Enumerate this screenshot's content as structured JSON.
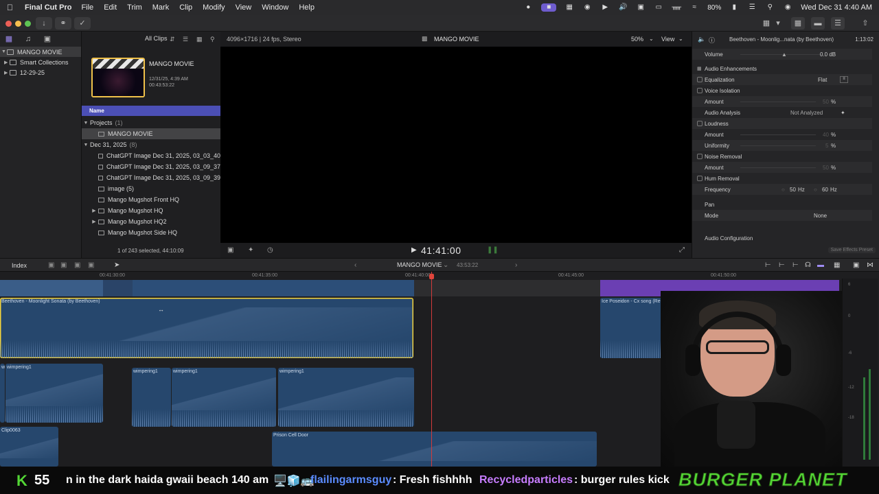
{
  "menubar": {
    "app_name": "Final Cut Pro",
    "items": [
      "File",
      "Edit",
      "Trim",
      "Mark",
      "Clip",
      "Modify",
      "View",
      "Window",
      "Help"
    ],
    "battery": "80%",
    "clock": "Wed Dec 31  4:40 AM"
  },
  "libraries": {
    "tabs": [
      "libraries-icon",
      "photos-icon",
      "titles-icon"
    ],
    "items": [
      {
        "label": "MANGO MOVIE",
        "selected": true
      },
      {
        "label": "Smart Collections"
      },
      {
        "label": "12-29-25"
      }
    ]
  },
  "browser": {
    "filter": "All Clips",
    "project_card": {
      "title": "MANGO MOVIE",
      "date": "12/31/25, 4:39 AM",
      "duration": "00:43:53:22"
    },
    "column_header": "Name",
    "rows": [
      {
        "label": "Projects",
        "count": "(1)",
        "group": true
      },
      {
        "label": "MANGO MOVIE",
        "selected": true
      },
      {
        "label": "Dec 31, 2025",
        "count": "(8)",
        "group": true
      },
      {
        "label": "ChatGPT Image Dec 31, 2025, 03_03_40"
      },
      {
        "label": "ChatGPT Image Dec 31, 2025, 03_09_37"
      },
      {
        "label": "ChatGPT Image Dec 31, 2025, 03_09_39"
      },
      {
        "label": "image (5)"
      },
      {
        "label": "Mango Mugshot Front HQ"
      },
      {
        "label": "Mango Mugshot HQ"
      },
      {
        "label": "Mango Mugshot HQ2"
      },
      {
        "label": "Mango Mugshot Side HQ"
      }
    ],
    "status": "1 of 243 selected, 44:10:09"
  },
  "viewer": {
    "format": "4096×1716 | 24 fps, Stereo",
    "title": "MANGO MOVIE",
    "zoom": "50%",
    "view_label": "View",
    "timecode": "41:41:00"
  },
  "inspector": {
    "clip_title": "Beethoven - Moonlig...nata (by Beethoven)",
    "duration": "1:13:02",
    "volume_label": "Volume",
    "volume_value": "0.0  dB",
    "enhancements_label": "Audio Enhancements",
    "equalization_label": "Equalization",
    "equalization_value": "Flat",
    "voice_isolation_label": "Voice Isolation",
    "amount_label": "Amount",
    "voice_amount": "50",
    "percent": "%",
    "analysis_label": "Audio Analysis",
    "analysis_value": "Not Analyzed",
    "loudness_label": "Loudness",
    "loudness_amount": "40",
    "uniformity_label": "Uniformity",
    "uniformity_value": "5",
    "noise_label": "Noise Removal",
    "noise_amount": "50",
    "hum_label": "Hum Removal",
    "frequency_label": "Frequency",
    "freq_50": "50",
    "freq_60": "60",
    "hz": "Hz",
    "pan_label": "Pan",
    "mode_label": "Mode",
    "mode_value": "None",
    "config_label": "Audio Configuration",
    "save_label": "Save Effects Preset"
  },
  "timeline_bar": {
    "index_label": "Index",
    "project": "MANGO MOVIE",
    "duration": "43:53:22"
  },
  "timeline": {
    "ruler": [
      "00:41:30:00",
      "00:41:35:00",
      "00:41:40:00",
      "00:41:45:00",
      "00:41:50:00"
    ],
    "clips": {
      "beethoven": "Beethoven - Moonlight Sonata (by Beethoven)",
      "poseidon": "Ice Poseidon - Cx song (Reupload)",
      "w": "w",
      "wimp1": "wimpering1",
      "wimp2": "wimpering1",
      "wimp3": "wimpering1",
      "wimp4": "wimpering1",
      "clip0063": "Clip0063",
      "prison": "Prison Cell Door"
    },
    "meter_marks": [
      "6",
      "0",
      "-6",
      "-12",
      "-18"
    ]
  },
  "ticker": {
    "k": "K",
    "count": "55",
    "messages": [
      {
        "text": "n in the dark haida gwaii beach 140 am",
        "color": "#ffffff"
      },
      {
        "text": "🖥️🧊🚌",
        "color": "#ffffff"
      },
      {
        "text": "flailingarmsguy",
        "color": "#5b8cff"
      },
      {
        "text": ": Fresh fishhhh",
        "color": "#ffffff"
      },
      {
        "text": "Recycledparticles",
        "color": "#c77dff"
      },
      {
        "text": ": burger rules kick",
        "color": "#ffffff"
      }
    ],
    "brand": "BURGER PLANET"
  },
  "colors": {
    "accent": "#6e5ccd",
    "selection": "#f4d43b",
    "playhead": "#d33b3b",
    "clip_blue": "#26476d",
    "clip_purple": "#6b3fb3",
    "ticker_green": "#53d635"
  }
}
